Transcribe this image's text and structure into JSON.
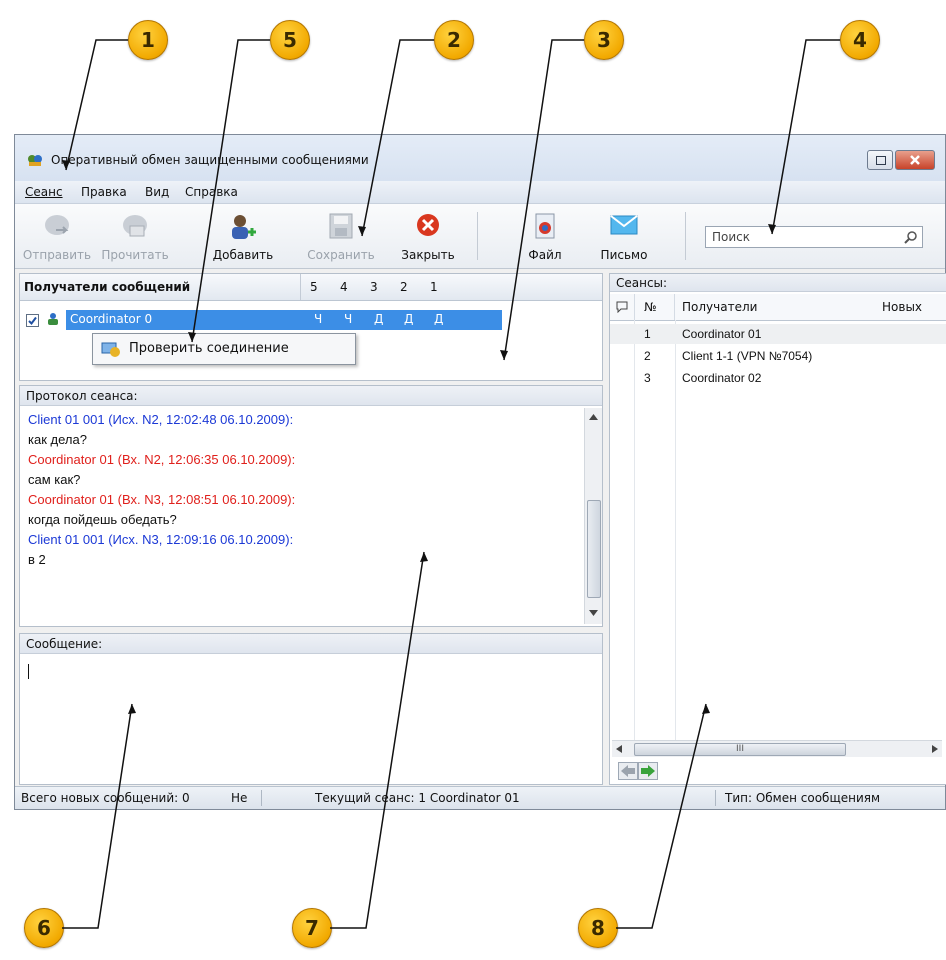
{
  "callouts": [
    "1",
    "5",
    "2",
    "3",
    "4",
    "6",
    "7",
    "8"
  ],
  "window": {
    "title": "Оперативный обмен защищенными сообщениями"
  },
  "menu": {
    "items": [
      "Сеанс",
      "Правка",
      "Вид",
      "Справка"
    ]
  },
  "toolbar": {
    "send": "Отправить",
    "read": "Прочитать",
    "add": "Добавить",
    "save": "Сохранить",
    "close": "Закрыть",
    "file": "Файл",
    "letter": "Письмо",
    "search_placeholder": "Поиск"
  },
  "recipients": {
    "header": "Получатели сообщений",
    "columns": [
      "5",
      "4",
      "3",
      "2",
      "1"
    ],
    "rows": [
      {
        "name": "Coordinator 0",
        "checked": true,
        "statuses": [
          "Ч",
          "Ч",
          "Д",
          "Д",
          "Д"
        ]
      }
    ],
    "context_menu": "Проверить соединение"
  },
  "log": {
    "title": "Протокол сеанса:",
    "lines": [
      {
        "text": "Client 01 001 (Исх. N2, 12:02:48 06.10.2009):",
        "color": "blue"
      },
      {
        "text": "как дела?",
        "color": "dark"
      },
      {
        "text": "Coordinator 01 (Вх. N2, 12:06:35 06.10.2009):",
        "color": "red"
      },
      {
        "text": "сам как?",
        "color": "dark"
      },
      {
        "text": "Coordinator 01 (Вх. N3, 12:08:51 06.10.2009):",
        "color": "red"
      },
      {
        "text": "когда пойдешь обедать?",
        "color": "dark"
      },
      {
        "text": "Client 01 001 (Исх. N3, 12:09:16 06.10.2009):",
        "color": "blue"
      },
      {
        "text": "в 2",
        "color": "dark"
      }
    ]
  },
  "message": {
    "title": "Сообщение:"
  },
  "sessions": {
    "title": "Сеансы:",
    "columns": {
      "num": "№",
      "recipients": "Получатели",
      "new": "Новых"
    },
    "rows": [
      {
        "num": "1",
        "name": "Coordinator 01"
      },
      {
        "num": "2",
        "name": "Client 1-1 (VPN №7054)"
      },
      {
        "num": "3",
        "name": "Coordinator 02"
      }
    ],
    "hscroll_mark": "III"
  },
  "status": {
    "total_new": "Всего новых сообщений: 0",
    "short": "Не",
    "current": "Текущий сеанс: 1  Coordinator 01",
    "type": "Тип: Обмен сообщениям"
  }
}
